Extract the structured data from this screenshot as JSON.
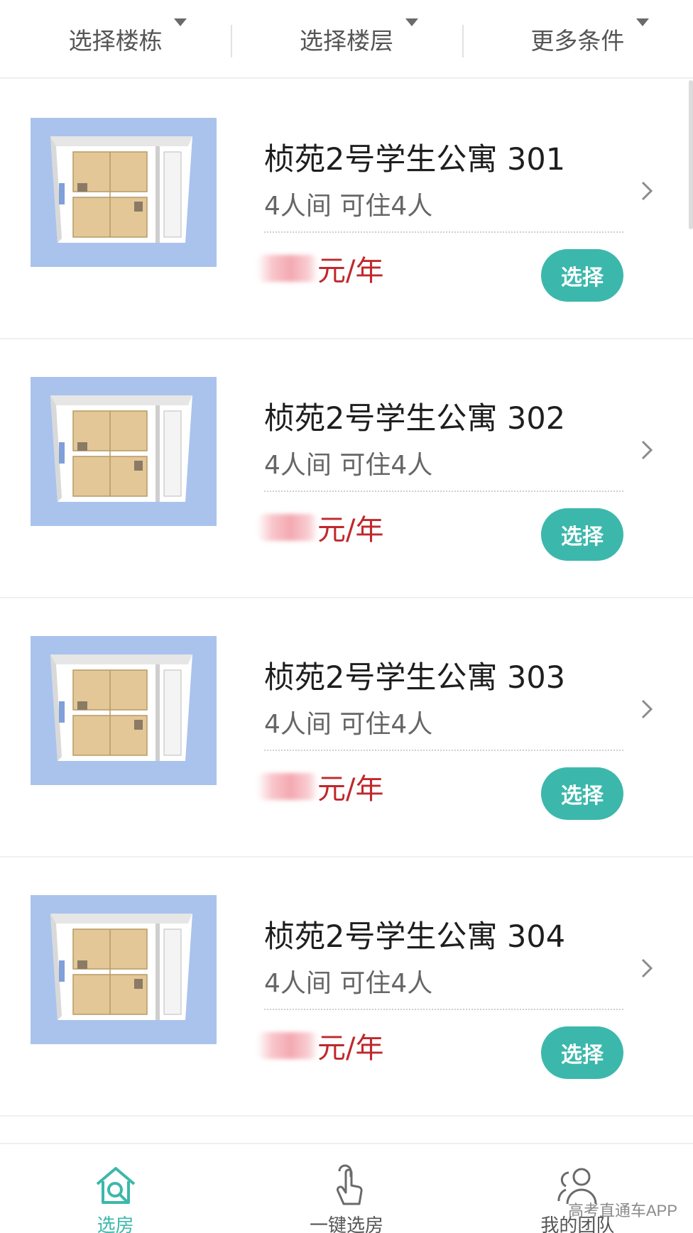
{
  "filters": [
    {
      "label": "选择楼栋"
    },
    {
      "label": "选择楼层"
    },
    {
      "label": "更多条件"
    }
  ],
  "rooms": [
    {
      "name": "桢苑2号学生公寓 301",
      "capacity": "4人间 可住4人",
      "price_unit": "元/年",
      "action_label": "选择"
    },
    {
      "name": "桢苑2号学生公寓 302",
      "capacity": "4人间 可住4人",
      "price_unit": "元/年",
      "action_label": "选择"
    },
    {
      "name": "桢苑2号学生公寓 303",
      "capacity": "4人间 可住4人",
      "price_unit": "元/年",
      "action_label": "选择"
    },
    {
      "name": "桢苑2号学生公寓 304",
      "capacity": "4人间 可住4人",
      "price_unit": "元/年",
      "action_label": "选择"
    }
  ],
  "tabs": [
    {
      "label": "选房",
      "icon": "home-search-icon",
      "active": true
    },
    {
      "label": "一键选房",
      "icon": "tap-hand-icon",
      "active": false
    },
    {
      "label": "我的团队",
      "icon": "team-icon",
      "active": false
    }
  ],
  "watermark": "高考直通车APP",
  "colors": {
    "accent": "#3bb8ab",
    "price": "#c0282c",
    "thumb_bg": "#a9c3ec"
  }
}
